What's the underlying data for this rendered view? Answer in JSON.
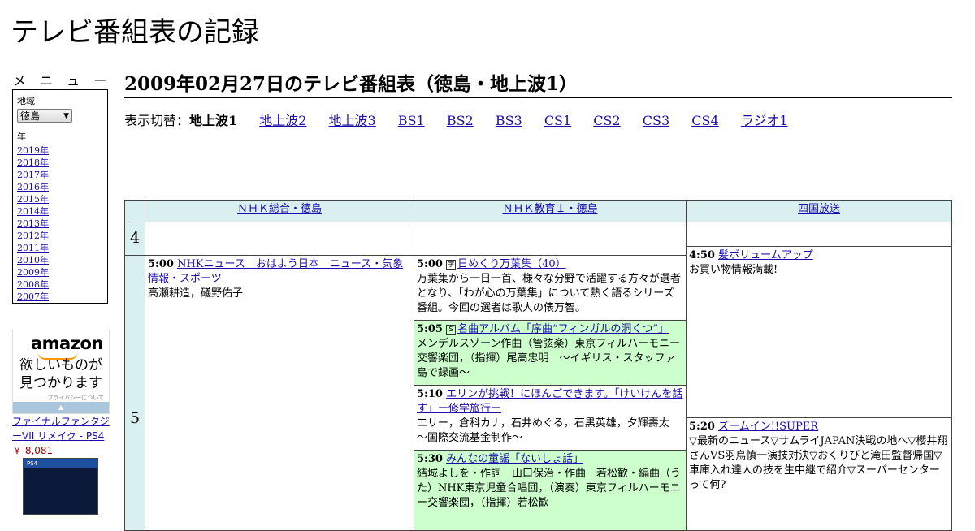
{
  "site": {
    "title": "テレビ番組表の記録"
  },
  "menu": {
    "heading": "メ ニ ュ ー",
    "region_label": "地域",
    "region_value": "徳島",
    "year_label": "年",
    "years": [
      "2019年",
      "2018年",
      "2017年",
      "2016年",
      "2015年",
      "2014年",
      "2013年",
      "2012年",
      "2011年",
      "2010年",
      "2009年",
      "2008年",
      "2007年"
    ]
  },
  "ad": {
    "logo": "amazon",
    "line1": "欲しいものが",
    "line2": "見つかります",
    "privacy": "プライバシーについて",
    "product_title": "ファイナルファンタジーVII リメイク - PS4",
    "product_price": "￥ 8,081",
    "product_badge": "PS4"
  },
  "main": {
    "title": "2009年02月27日のテレビ番組表（徳島・地上波1）",
    "switch_label": "表示切替：",
    "switch_current": "地上波1",
    "switch_links": [
      "地上波2",
      "地上波3",
      "BS1",
      "BS2",
      "BS3",
      "CS1",
      "CS2",
      "CS3",
      "CS4",
      "ラジオ1"
    ]
  },
  "schedule": {
    "channels": [
      "ＮＨＫ総合・徳島",
      "ＮＨＫ教育１・徳島",
      "四国放送"
    ],
    "hours": [
      "4",
      "5"
    ],
    "programs": {
      "nhk1_500": {
        "time": "5:00",
        "title": "NHKニュース　おはよう日本　ニュース・気象情報・スポーツ",
        "desc": "高瀬耕造，礒野佑子"
      },
      "edu_500": {
        "time": "5:00",
        "mark": "字",
        "title": "日めくり万葉集（40）",
        "desc": "万葉集から一日一首、様々な分野で活躍する方々が選者となり、「わが心の万葉集」について熱く語るシリーズ番組。今回の選者は歌人の俵万智。"
      },
      "edu_505": {
        "time": "5:05",
        "mark": "S",
        "title": "名曲アルバム「序曲“フィンガルの洞くつ”」",
        "desc": "メンデルスゾーン作曲（管弦楽）東京フィルハーモニー交響楽団，（指揮）尾高忠明　～イギリス・スタッファ島で録画～"
      },
      "edu_510": {
        "time": "5:10",
        "title": "エリンが挑戦！にほんごできます。「けいけんを話す」ー修学旅行ー",
        "desc": "エリー，倉科カナ，石井めぐる，石黒英雄，夕輝壽太　～国際交流基金制作～"
      },
      "edu_530": {
        "time": "5:30",
        "title": "みんなの童謡「ないしょ話」",
        "desc": "結城よしを・作詞　山口保治・作曲　若松歓・編曲（うた）NHK東京児童合唱団，（演奏）東京フィルハーモニー交響楽団，（指揮）若松歓"
      },
      "jrt_450": {
        "time": "4:50",
        "title": "髪ボリュームアップ",
        "desc": "お買い物情報満載!"
      },
      "jrt_520": {
        "time": "5:20",
        "title": "ズームイン!!SUPER",
        "desc": "▽最新のニュース▽サムライJAPAN決戦の地へ▽櫻井翔さんVS羽鳥慎一演技対決▽おくりびと滝田監督帰国▽車庫入れ達人の技を生中継で紹介▽スーパーセンターって何?"
      }
    }
  }
}
